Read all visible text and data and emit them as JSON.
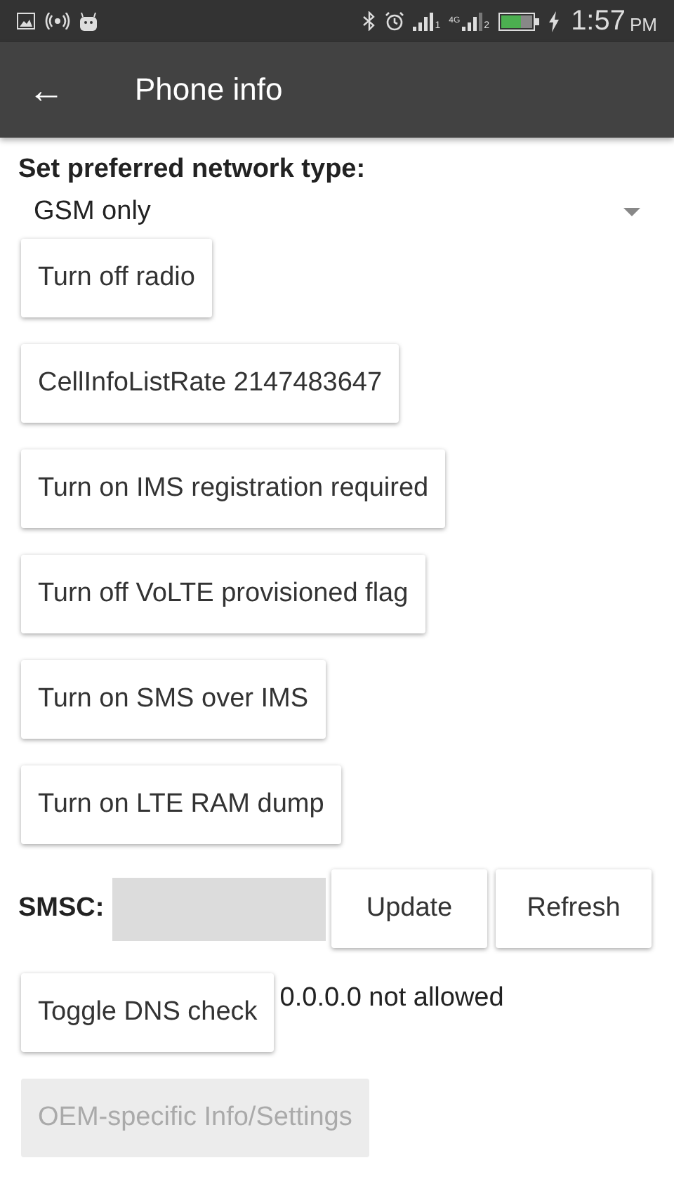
{
  "status_bar": {
    "time": "1:57",
    "am_pm": "PM",
    "sim_labels": [
      "1",
      "2"
    ],
    "network_label": "4G"
  },
  "app_bar": {
    "back_icon": "←",
    "title": "Phone info"
  },
  "network_type": {
    "label": "Set preferred network type:",
    "value": "GSM only"
  },
  "buttons": [
    {
      "label": "Turn off radio",
      "disabled": false
    },
    {
      "label": "CellInfoListRate 2147483647",
      "disabled": false
    },
    {
      "label": "Turn on IMS registration required",
      "disabled": false
    },
    {
      "label": "Turn off VoLTE provisioned flag",
      "disabled": false
    },
    {
      "label": "Turn on SMS over IMS",
      "disabled": false
    },
    {
      "label": "Turn on LTE RAM dump",
      "disabled": false
    }
  ],
  "smsc": {
    "label": "SMSC:",
    "buttons": [
      {
        "label": "Update",
        "disabled": false
      },
      {
        "label": "Refresh",
        "disabled": false
      }
    ]
  },
  "dns": {
    "button": {
      "label": "Toggle DNS check",
      "disabled": false
    },
    "status": "0.0.0.0 not allowed"
  },
  "oem_button": {
    "label": "OEM-specific Info/Settings",
    "disabled": true
  }
}
